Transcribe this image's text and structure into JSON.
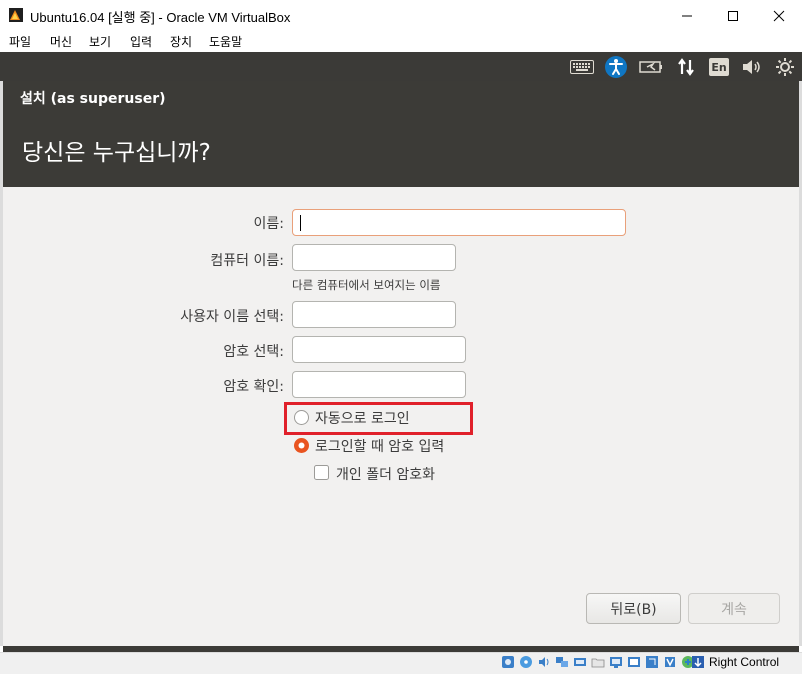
{
  "window": {
    "title": "Ubuntu16.04 [실행 중] - Oracle VM VirtualBox",
    "minimize_glyph": "—",
    "maximize_glyph": "☐",
    "close_glyph": "✕"
  },
  "menubar": {
    "items": [
      {
        "label": "파일"
      },
      {
        "label": "머신"
      },
      {
        "label": "보기"
      },
      {
        "label": "입력"
      },
      {
        "label": "장치"
      },
      {
        "label": "도움말"
      }
    ]
  },
  "panel": {
    "icons": [
      "keyboard-icon",
      "accessibility-icon",
      "battery-icon",
      "network-icon",
      "language-indicator",
      "volume-icon",
      "settings-icon"
    ],
    "language": "En",
    "accent": "#0f76c3"
  },
  "installer": {
    "title": "설치 (as superuser)",
    "question": "당신은 누구십니까?",
    "fields": {
      "name_label": "이름:",
      "name_value": "",
      "computer_label": "컴퓨터 이름:",
      "computer_value": "",
      "computer_hint": "다른 컴퓨터에서 보여지는 이름",
      "username_label": "사용자 이름 선택:",
      "username_value": "",
      "password_label": "암호 선택:",
      "password_value": "",
      "confirm_label": "암호 확인:",
      "confirm_value": ""
    },
    "options": {
      "auto_login": "자동으로 로그인",
      "auto_login_selected": false,
      "require_password": "로그인할 때 암호 입력",
      "require_password_selected": true,
      "encrypt_home": "개인 폴더 암호화",
      "encrypt_home_checked": false
    },
    "buttons": {
      "back": "뒤로(B)",
      "continue": "계속"
    },
    "colors": {
      "focus_border": "#e9a07a",
      "radio_selected": "#e95420",
      "highlight_box": "#e0202a"
    }
  },
  "statusbar": {
    "host_key": "Right Control"
  }
}
